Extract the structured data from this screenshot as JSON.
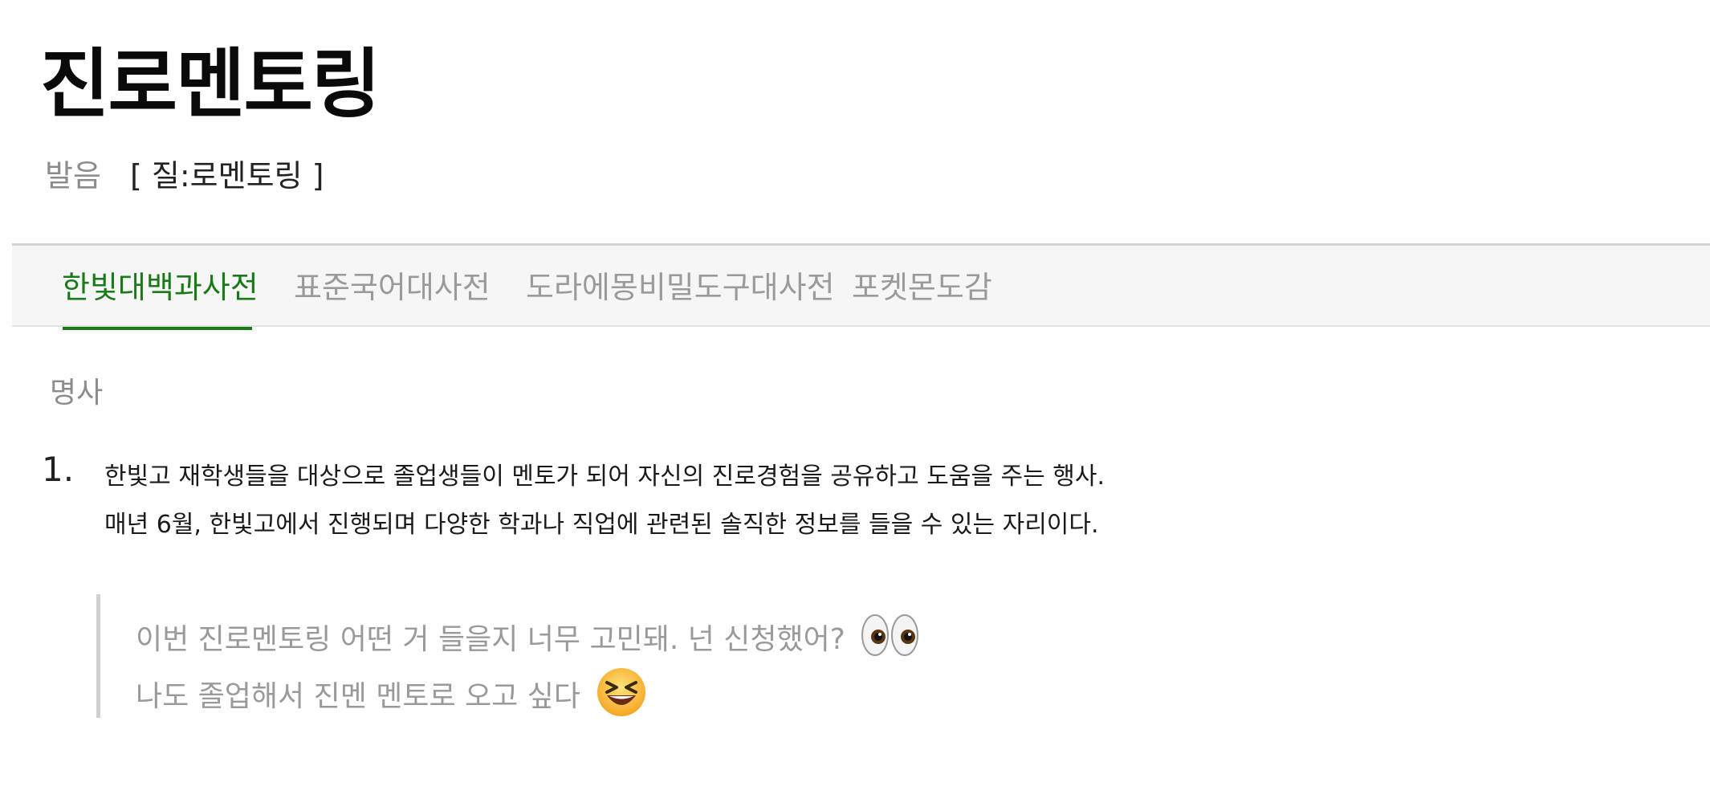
{
  "entry": {
    "headword": "진로멘토링",
    "pronunciation_label": "발음",
    "pronunciation": "[ 질:로멘토링 ]"
  },
  "tabs": [
    {
      "label": "한빛대백과사전",
      "active": true
    },
    {
      "label": "표준국어대사전",
      "active": false
    },
    {
      "label": "도라에몽비밀도구대사전",
      "active": false
    },
    {
      "label": "포켓몬도감",
      "active": false
    }
  ],
  "definition": {
    "part_of_speech": "명사",
    "number": "1.",
    "lines": [
      "한빛고 재학생들을 대상으로 졸업생들이 멘토가 되어 자신의 진로경험을 공유하고 도움을 주는 행사.",
      "매년 6월, 한빛고에서 진행되며 다양한 학과나 직업에 관련된 솔직한 정보를 들을 수 있는 자리이다."
    ]
  },
  "example": {
    "lines": [
      {
        "text": "이번 진로멘토링 어떤 거 들을지 너무 고민돼. 넌 신청했어?",
        "emoji": "eyes-emoji"
      },
      {
        "text": "나도 졸업해서 진멘 멘토로 오고 싶다",
        "emoji": "laughing-face-emoji"
      }
    ]
  },
  "colors": {
    "accent": "#1a7a1a",
    "muted": "#9a9a9a",
    "tab_bar_bg": "#f6f6f6"
  }
}
